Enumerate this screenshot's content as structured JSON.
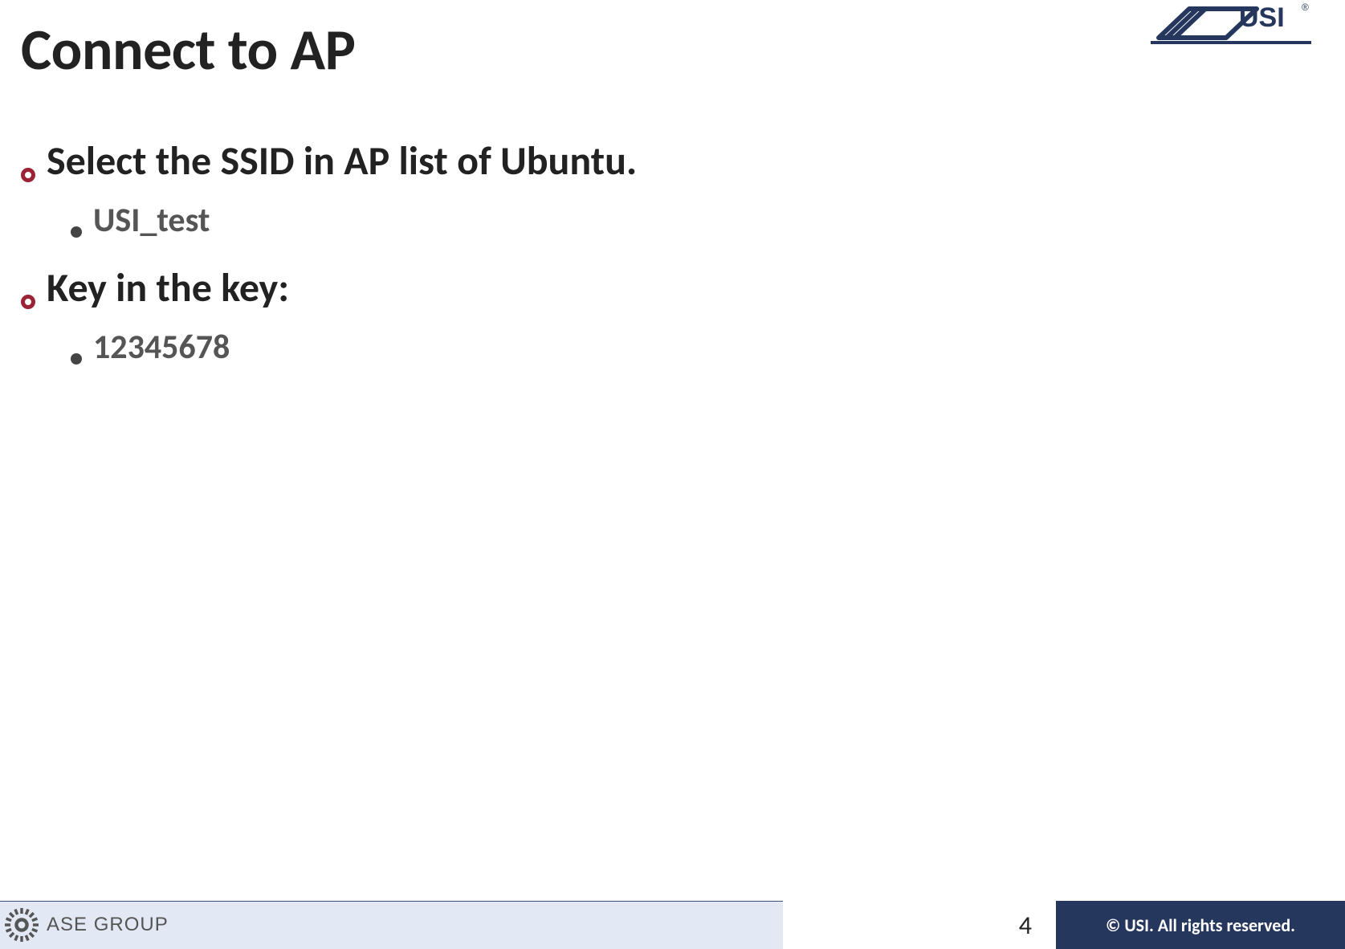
{
  "title": "Connect to AP",
  "logo": {
    "name": "USI",
    "registered": "®"
  },
  "bullets": [
    {
      "level": 1,
      "text": "Select the SSID in AP list of Ubuntu.",
      "children": [
        {
          "level": 2,
          "text": "USI_test"
        }
      ]
    },
    {
      "level": 1,
      "text": "Key in the key:",
      "children": [
        {
          "level": 2,
          "text": "12345678"
        }
      ]
    }
  ],
  "footer": {
    "ase_group": "ASE GROUP",
    "page_number": "4",
    "copyright": "© USI. All rights reserved."
  },
  "colors": {
    "accent_red": "#9b2335",
    "brand_navy": "#26375e",
    "footer_light": "#e2e8f4"
  }
}
